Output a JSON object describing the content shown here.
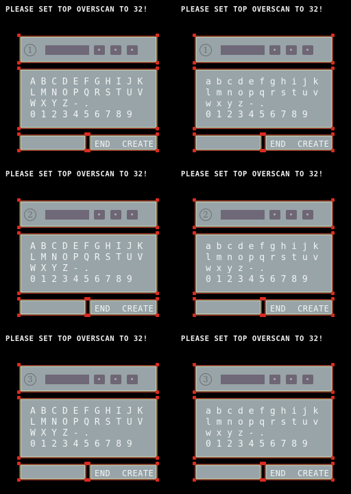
{
  "warning": "PLEASE SET TOP OVERSCAN TO 32!",
  "buttons": {
    "end": "END",
    "create": "CREATE"
  },
  "panels": [
    {
      "slot": "1",
      "rows": [
        "A B C D E F G H I J K",
        "L M N O P Q R S T U V",
        "W X Y Z - .",
        "0 1 2 3 4 5 6 7 8 9"
      ]
    },
    {
      "slot": "1",
      "rows": [
        "a b c d e f g h i j k",
        "l m n o p q r s t u v",
        "w x y z - .",
        "0 1 2 3 4 5 6 7 8 9"
      ]
    },
    {
      "slot": "2",
      "rows": [
        "A B C D E F G H I J K",
        "L M N O P Q R S T U V",
        "W X Y Z - .",
        "0 1 2 3 4 5 6 7 8 9"
      ]
    },
    {
      "slot": "2",
      "rows": [
        "a b c d e f g h i j k",
        "l m n o p q r s t u v",
        "w x y z - .",
        "0 1 2 3 4 5 6 7 8 9"
      ]
    },
    {
      "slot": "3",
      "rows": [
        "A B C D E F G H I J K",
        "L M N O P Q R S T U V",
        "W X Y Z - .",
        "0 1 2 3 4 5 6 7 8 9"
      ]
    },
    {
      "slot": "3",
      "rows": [
        "a b c d e f g h i j k",
        "l m n o p q r s t u v",
        "w x y z - .",
        "0 1 2 3 4 5 6 7 8 9"
      ]
    }
  ],
  "colors": {
    "panel": "#98a4a8",
    "text": "#f2f4f4",
    "bar": "#6f6878",
    "handle": "#e02a20"
  }
}
